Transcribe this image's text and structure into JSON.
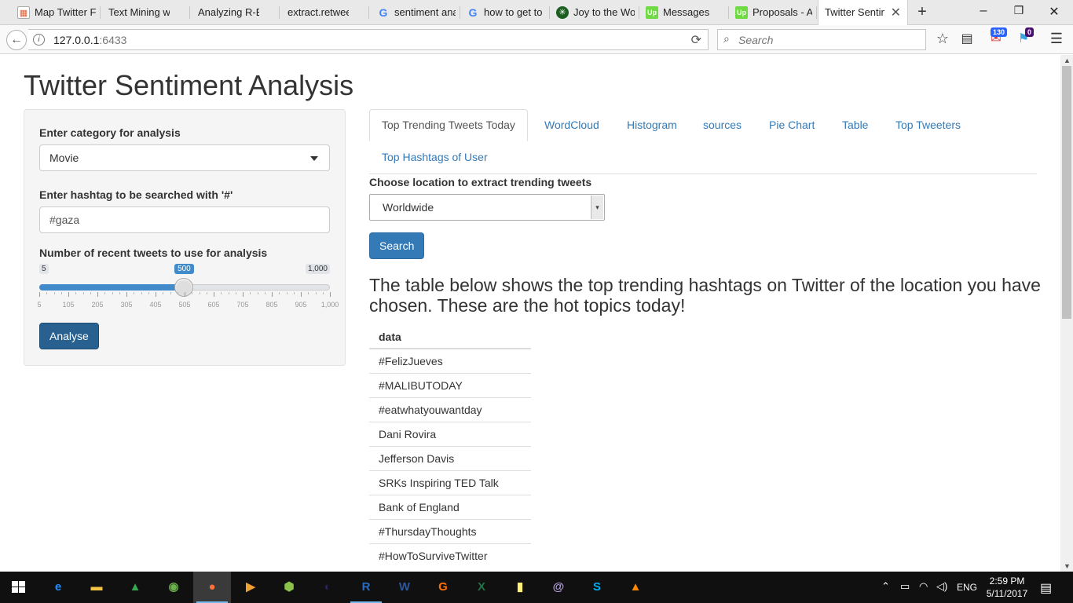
{
  "browser": {
    "tabs": [
      {
        "label": "Map Twitter F",
        "icon": "chrome-apps-icon",
        "color": "#e25d33"
      },
      {
        "label": "Text Mining with F",
        "icon": "page-icon",
        "color": "#ffffff"
      },
      {
        "label": "Analyzing R-Blogg",
        "icon": "page-icon",
        "color": "#ffffff"
      },
      {
        "label": "extract.retweets fu",
        "icon": "page-icon",
        "color": "#ffffff"
      },
      {
        "label": "sentiment ana",
        "icon": "google-icon",
        "color": "#4285f4"
      },
      {
        "label": "how to get to",
        "icon": "google-icon",
        "color": "#4285f4"
      },
      {
        "label": "Joy to the Wo",
        "icon": "joy-icon",
        "color": "#1b5e20"
      },
      {
        "label": "Messages",
        "icon": "upwork-icon",
        "color": "#6fda44"
      },
      {
        "label": "Proposals - A",
        "icon": "upwork-icon",
        "color": "#6fda44"
      },
      {
        "label": "Twitter Sentim",
        "icon": "none",
        "color": "#ffffff"
      }
    ],
    "new_tab_glyph": "+",
    "url_host": "127.0.0.1",
    "url_port": ":6433",
    "search_placeholder": "Search",
    "badge_mail": "130",
    "badge_other": "0"
  },
  "page": {
    "title": "Twitter Sentiment Analysis",
    "sidebar": {
      "category_label": "Enter category for analysis",
      "category_value": "Movie",
      "hashtag_label": "Enter hashtag to be searched with '#'",
      "hashtag_value": "#gaza",
      "tweets_label": "Number of recent tweets to use for analysis",
      "slider": {
        "min": 5,
        "max": 1000,
        "value": 500,
        "min_label": "5",
        "max_label": "1,000",
        "value_label": "500",
        "tick_labels": [
          "5",
          "105",
          "205",
          "305",
          "405",
          "505",
          "605",
          "705",
          "805",
          "905",
          "1,000"
        ]
      },
      "analyse_label": "Analyse"
    },
    "tabs": [
      "Top Trending Tweets Today",
      "WordCloud",
      "Histogram",
      "sources",
      "Pie Chart",
      "Table",
      "Top Tweeters",
      "Top Hashtags of User"
    ],
    "location_label": "Choose location to extract trending tweets",
    "location_value": "Worldwide",
    "search_label": "Search",
    "description": "The table below shows the top trending hashtags on Twitter of the location you have chosen. These are the hot topics today!",
    "table": {
      "header": "data",
      "rows": [
        "#FelizJueves",
        "#MALIBUTODAY",
        "#eatwhatyouwantday",
        "Dani Rovira",
        "Jefferson Davis",
        "SRKs Inspiring TED Talk",
        "Bank of England",
        "#ThursdayThoughts",
        "#HowToSurviveTwitter"
      ]
    }
  },
  "taskbar": {
    "apps": [
      {
        "name": "edge-icon",
        "glyph": "e",
        "color": "#1e90ff"
      },
      {
        "name": "file-explorer-icon",
        "glyph": "▬",
        "color": "#f4c542"
      },
      {
        "name": "google-drive-icon",
        "glyph": "▲",
        "color": "#34a853"
      },
      {
        "name": "globe-app-icon",
        "glyph": "◉",
        "color": "#6ab04c"
      },
      {
        "name": "firefox-icon",
        "glyph": "●",
        "color": "#ff7139"
      },
      {
        "name": "video-player-icon",
        "glyph": "▶",
        "color": "#f0a030"
      },
      {
        "name": "android-app-icon",
        "glyph": "⬢",
        "color": "#8bc34a"
      },
      {
        "name": "eclipse-icon",
        "glyph": "◐",
        "color": "#2c2255"
      },
      {
        "name": "r-icon",
        "glyph": "R",
        "color": "#276dc3"
      },
      {
        "name": "word-icon",
        "glyph": "W",
        "color": "#2b579a"
      },
      {
        "name": "pdf-app-icon",
        "glyph": "G",
        "color": "#ff6f00"
      },
      {
        "name": "excel-icon",
        "glyph": "X",
        "color": "#217346"
      },
      {
        "name": "sticky-notes-icon",
        "glyph": "▮",
        "color": "#fff176"
      },
      {
        "name": "spiral-app-icon",
        "glyph": "@",
        "color": "#b39ddb"
      },
      {
        "name": "skype-icon",
        "glyph": "S",
        "color": "#00aff0"
      },
      {
        "name": "vlc-icon",
        "glyph": "▲",
        "color": "#ff8800"
      }
    ],
    "language": "ENG",
    "time": "2:59 PM",
    "date": "5/11/2017"
  }
}
